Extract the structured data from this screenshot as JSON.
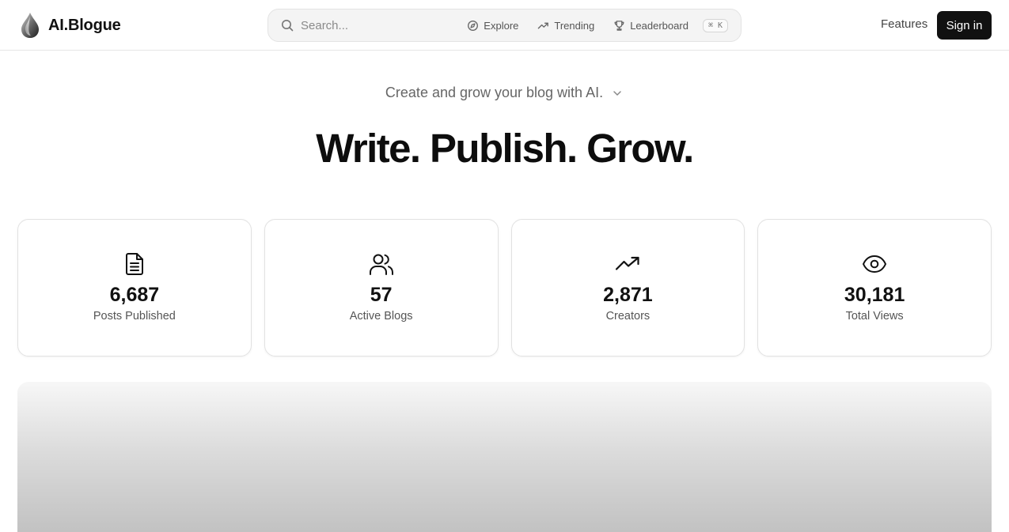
{
  "header": {
    "brand_name": "AI.Blogue",
    "logo_icon": "ink-drop-icon",
    "search": {
      "placeholder": "Search...",
      "value": ""
    },
    "nav": [
      {
        "label": "Explore",
        "icon": "compass-icon"
      },
      {
        "label": "Trending",
        "icon": "trending-icon"
      },
      {
        "label": "Leaderboard",
        "icon": "trophy-icon"
      }
    ],
    "shortcut": "⌘ K",
    "features_label": "Features",
    "signin_label": "Sign in"
  },
  "hero": {
    "tagline": "Create and grow your blog with AI.",
    "title": "Write. Publish. Grow."
  },
  "stats": [
    {
      "value": "6,687",
      "label": "Posts Published",
      "icon": "document-icon"
    },
    {
      "value": "57",
      "label": "Active Blogs",
      "icon": "users-icon"
    },
    {
      "value": "2,871",
      "label": "Creators",
      "icon": "trending-up-icon"
    },
    {
      "value": "30,181",
      "label": "Total Views",
      "icon": "eye-icon"
    }
  ],
  "colors": {
    "primary": "#111111",
    "text_muted": "#666666",
    "border": "#e2e2e2"
  }
}
